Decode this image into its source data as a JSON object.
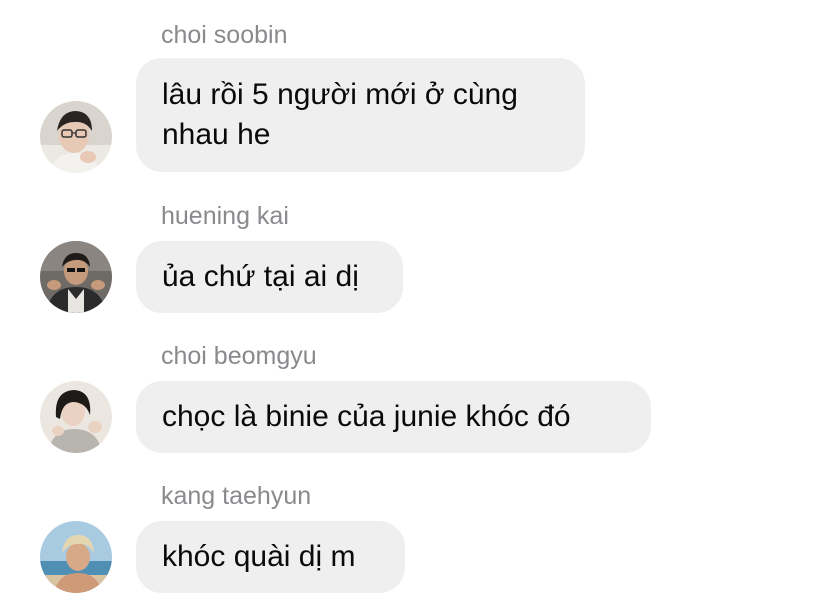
{
  "messages": [
    {
      "sender": "choi soobin",
      "text_line1": "lâu rồi 5 người mới ở cùng",
      "text_line2": "nhau he",
      "avatar_icon": "avatar-soobin-icon"
    },
    {
      "sender": "huening kai",
      "text_line1": "ủa chứ tại ai dị",
      "avatar_icon": "avatar-hueningkai-icon"
    },
    {
      "sender": "choi beomgyu",
      "text_line1": "chọc là binie của junie khóc đó",
      "avatar_icon": "avatar-beomgyu-icon"
    },
    {
      "sender": "kang taehyun",
      "text_line1": "khóc quài dị m",
      "avatar_icon": "avatar-taehyun-icon"
    }
  ],
  "colors": {
    "bubble": "#efefef",
    "sender_name": "#8a8a8e",
    "text": "#0a0a0a"
  }
}
